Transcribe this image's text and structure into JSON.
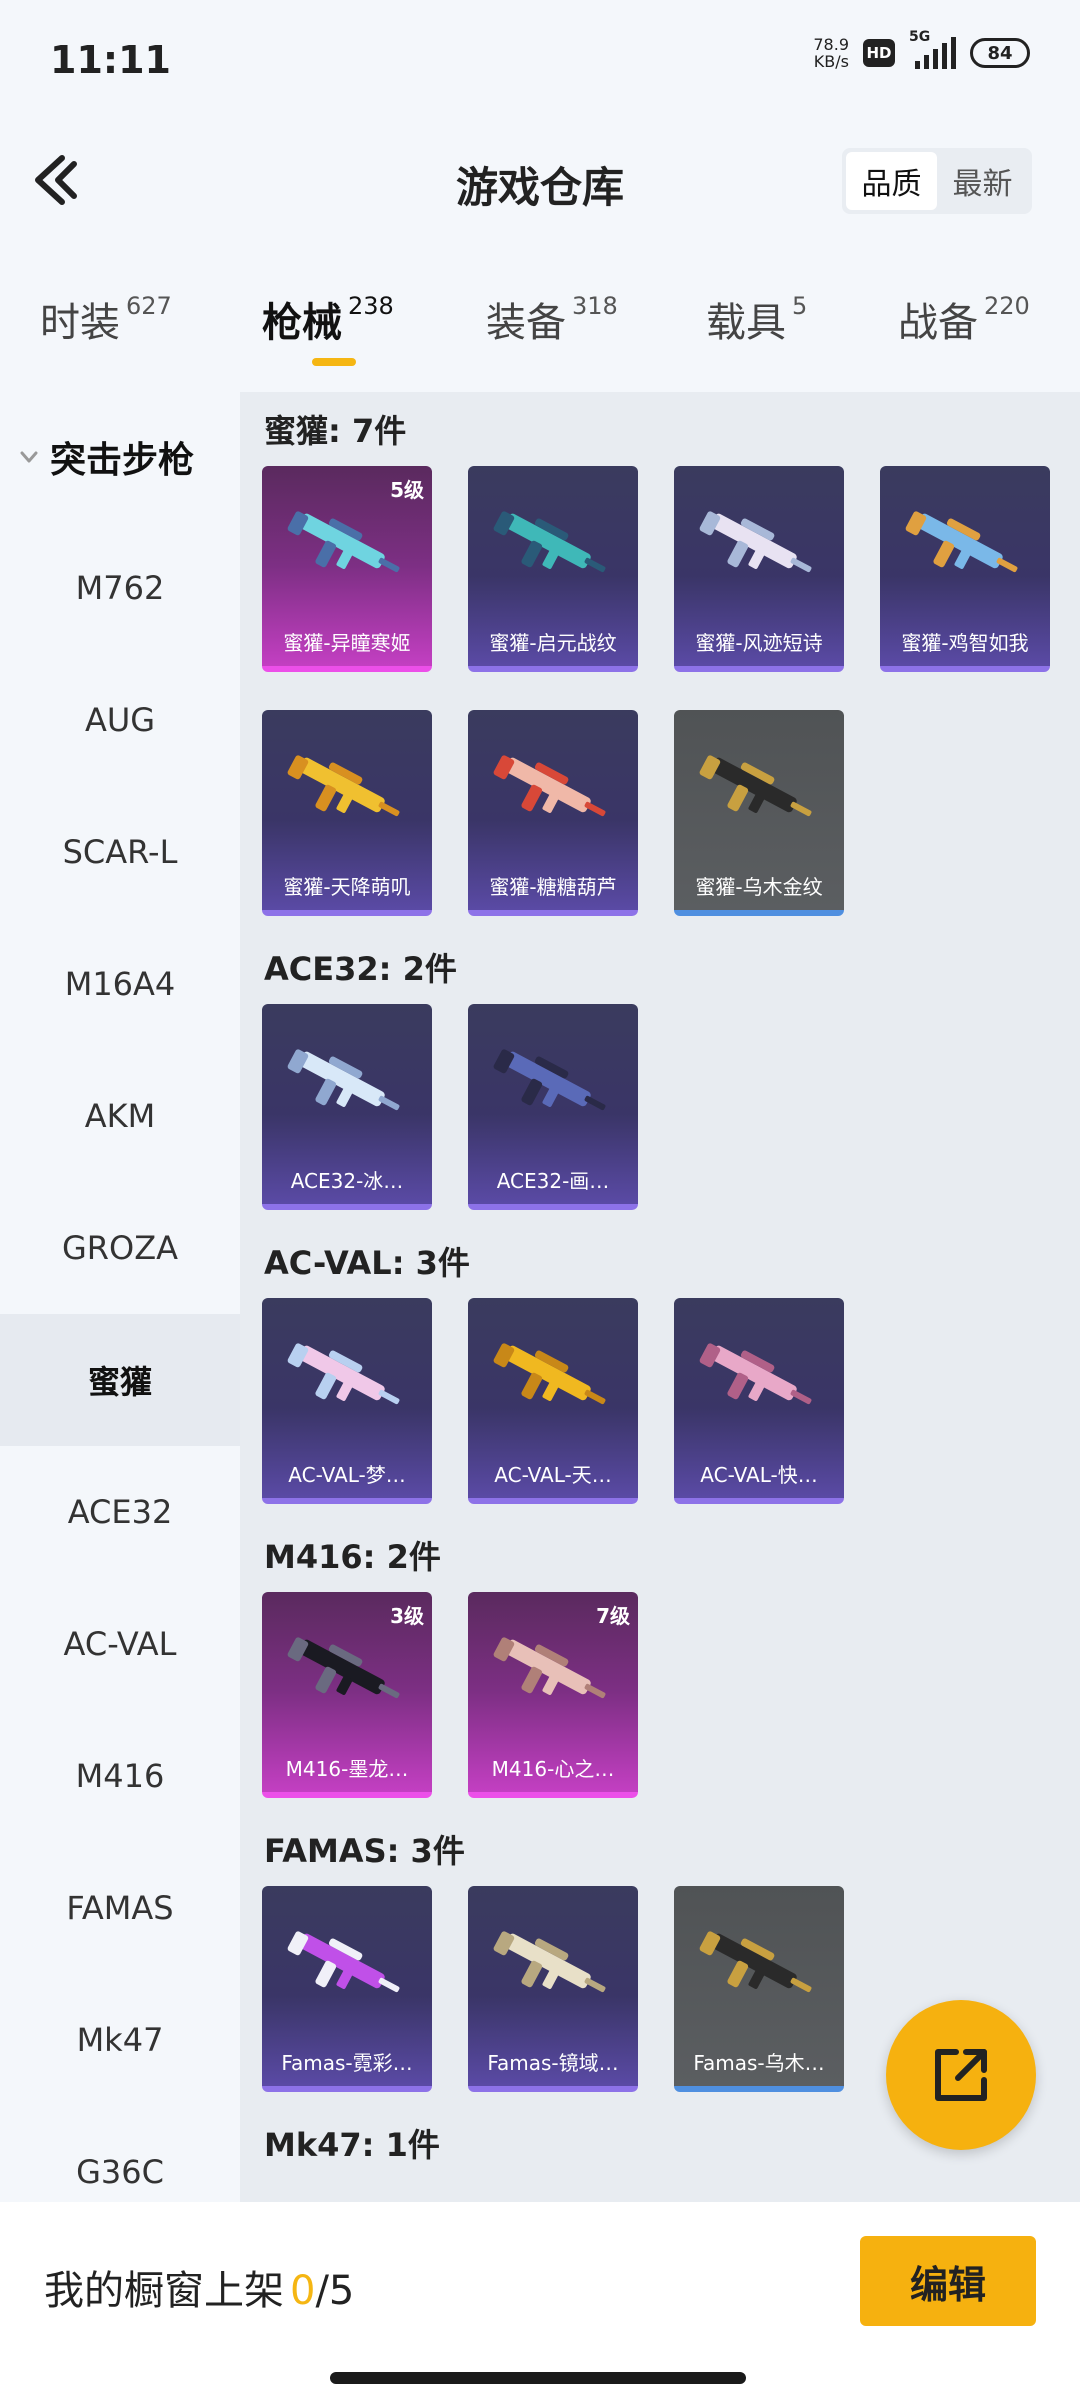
{
  "status_bar": {
    "time": "11:11",
    "net_speed_value": "78.9",
    "net_speed_unit": "KB/s",
    "hd": "HD",
    "network": "5G",
    "battery": "84"
  },
  "header": {
    "title": "游戏仓库",
    "sort_options": [
      "品质",
      "最新"
    ],
    "active_sort": "品质"
  },
  "tabs": [
    {
      "label": "时装",
      "count": "627"
    },
    {
      "label": "枪械",
      "count": "238"
    },
    {
      "label": "装备",
      "count": "318"
    },
    {
      "label": "载具",
      "count": "5"
    },
    {
      "label": "战备",
      "count": "220"
    }
  ],
  "active_tab": "枪械",
  "sidebar": {
    "category": "突击步枪",
    "items": [
      "M762",
      "AUG",
      "SCAR-L",
      "M16A4",
      "AKM",
      "GROZA",
      "蜜獾",
      "ACE32",
      "AC-VAL",
      "M416",
      "FAMAS",
      "Mk47",
      "G36C"
    ],
    "active_item": "蜜獾"
  },
  "groups": [
    {
      "title": "蜜獾: 7件",
      "items": [
        {
          "name": "蜜獾-异瞳寒姬",
          "level": "5级",
          "rarity": "pink",
          "colors": [
            "#6fd4e0",
            "#4a6fa8"
          ]
        },
        {
          "name": "蜜獾-启元战纹",
          "level": "",
          "rarity": "purple",
          "colors": [
            "#3fb8b8",
            "#2a5a78"
          ]
        },
        {
          "name": "蜜獾-风迹短诗",
          "level": "",
          "rarity": "purple",
          "colors": [
            "#e8e2f2",
            "#a8b8d8"
          ]
        },
        {
          "name": "蜜獾-鸡智如我",
          "level": "",
          "rarity": "purple",
          "colors": [
            "#7ab8e8",
            "#e0a040"
          ]
        },
        {
          "name": "蜜獾-天降萌叽",
          "level": "",
          "rarity": "purple",
          "colors": [
            "#f0c030",
            "#d89020"
          ]
        },
        {
          "name": "蜜獾-糖糖葫芦",
          "level": "",
          "rarity": "purple",
          "colors": [
            "#f0b8a8",
            "#d84838"
          ]
        },
        {
          "name": "蜜獾-乌木金纹",
          "level": "",
          "rarity": "grey",
          "colors": [
            "#2a2a2a",
            "#c8a040"
          ]
        }
      ]
    },
    {
      "title": "ACE32: 2件",
      "items": [
        {
          "name": "ACE32-冰…",
          "level": "",
          "rarity": "purple",
          "colors": [
            "#d8e8f8",
            "#90a8d0"
          ]
        },
        {
          "name": "ACE32-画…",
          "level": "",
          "rarity": "purple",
          "colors": [
            "#5a6ab8",
            "#2a2a48"
          ]
        }
      ]
    },
    {
      "title": "AC-VAL: 3件",
      "items": [
        {
          "name": "AC-VAL-梦…",
          "level": "",
          "rarity": "purple",
          "colors": [
            "#f0c8e8",
            "#b8d0f0"
          ]
        },
        {
          "name": "AC-VAL-天…",
          "level": "",
          "rarity": "purple",
          "colors": [
            "#f0b820",
            "#c88818"
          ]
        },
        {
          "name": "AC-VAL-快…",
          "level": "",
          "rarity": "purple",
          "colors": [
            "#e8a8c8",
            "#b06088"
          ]
        }
      ]
    },
    {
      "title": "M416: 2件",
      "items": [
        {
          "name": "M416-墨龙…",
          "level": "3级",
          "rarity": "pink",
          "colors": [
            "#1a1a22",
            "#6a6a80"
          ]
        },
        {
          "name": "M416-心之…",
          "level": "7级",
          "rarity": "pink",
          "colors": [
            "#e8c0b8",
            "#b08078"
          ]
        }
      ]
    },
    {
      "title": "FAMAS: 3件",
      "items": [
        {
          "name": "Famas-霓彩…",
          "level": "",
          "rarity": "purple",
          "colors": [
            "#c050e8",
            "#f0f0f8"
          ]
        },
        {
          "name": "Famas-镜域…",
          "level": "",
          "rarity": "purple",
          "colors": [
            "#e8e0c8",
            "#b8a880"
          ]
        },
        {
          "name": "Famas-乌木…",
          "level": "",
          "rarity": "grey",
          "colors": [
            "#2a2a2a",
            "#c8a040"
          ]
        }
      ]
    },
    {
      "title": "Mk47: 1件",
      "items": []
    }
  ],
  "bottom_bar": {
    "label": "我的橱窗上架",
    "count_current": "0",
    "count_total": "/5",
    "edit_label": "编辑"
  },
  "accent_color": "#f6b10f"
}
